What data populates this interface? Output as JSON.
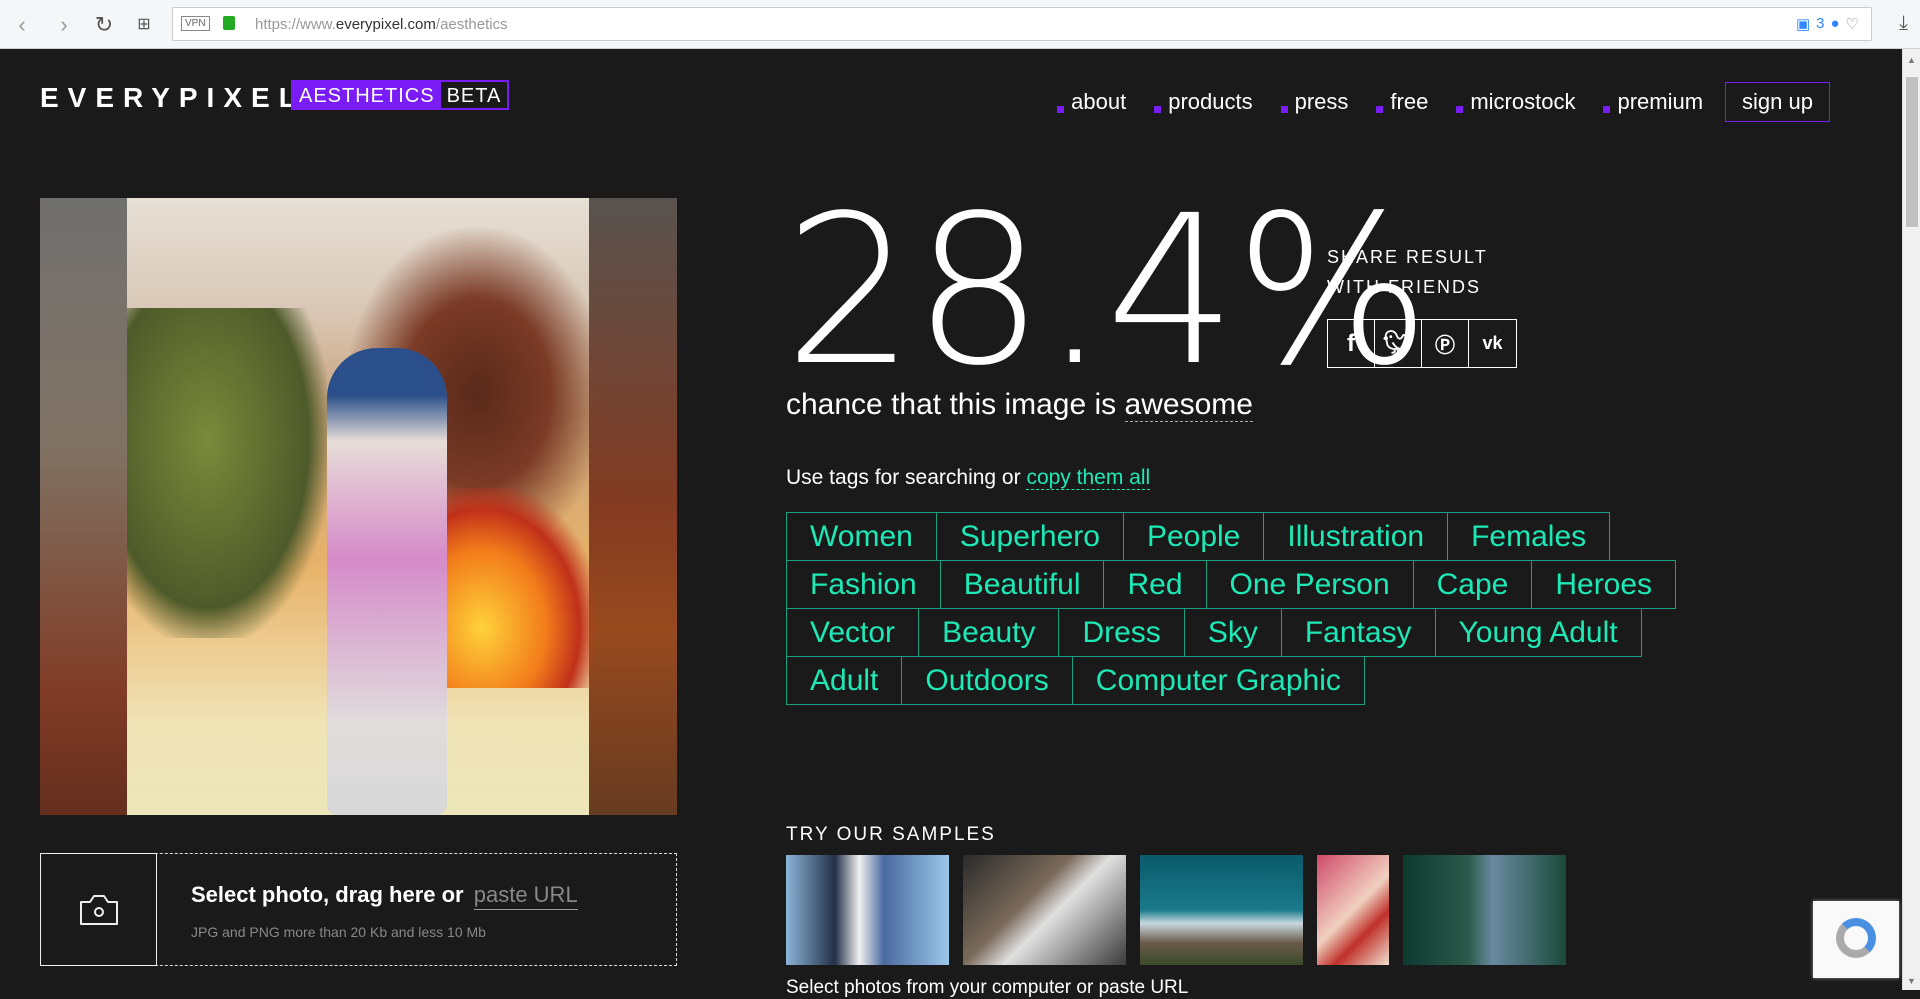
{
  "browser": {
    "vpn": "VPN",
    "url_prefix": "https://www.",
    "url_domain": "everypixel.com",
    "url_path": "/aesthetics",
    "ext_count": "3"
  },
  "header": {
    "logo": "EVERYPIXEL",
    "badge_main": "AESTHETICS",
    "badge_beta": "BETA",
    "menu": [
      "about",
      "products",
      "press",
      "free",
      "microstock",
      "premium"
    ],
    "signup": "sign up"
  },
  "result": {
    "score": "28.4%",
    "chance_prefix": "chance that this image is",
    "chance_word": "awesome",
    "share_line1": "SHARE RESULT",
    "share_line2": "WITH FRIENDS",
    "social": [
      "f",
      "t",
      "p",
      "vk"
    ]
  },
  "tags": {
    "prompt": "Use tags for searching or",
    "copy_link": "copy them all",
    "rows": [
      [
        "Women",
        "Superhero",
        "People",
        "Illustration",
        "Females"
      ],
      [
        "Fashion",
        "Beautiful",
        "Red",
        "One Person",
        "Cape",
        "Heroes"
      ],
      [
        "Vector",
        "Beauty",
        "Dress",
        "Sky",
        "Fantasy",
        "Young Adult"
      ],
      [
        "Adult",
        "Outdoors",
        "Computer Graphic"
      ]
    ]
  },
  "upload": {
    "main": "Select photo, drag here or",
    "paste": "paste URL",
    "sub": "JPG and PNG more than 20 Kb and less 10 Mb"
  },
  "samples": {
    "title": "TRY OUR SAMPLES",
    "footer": "Select photos from your computer or paste URL"
  },
  "colors": {
    "accent": "#7a1cf6",
    "tag": "#1de9b6",
    "bg": "#1a1a1a"
  }
}
